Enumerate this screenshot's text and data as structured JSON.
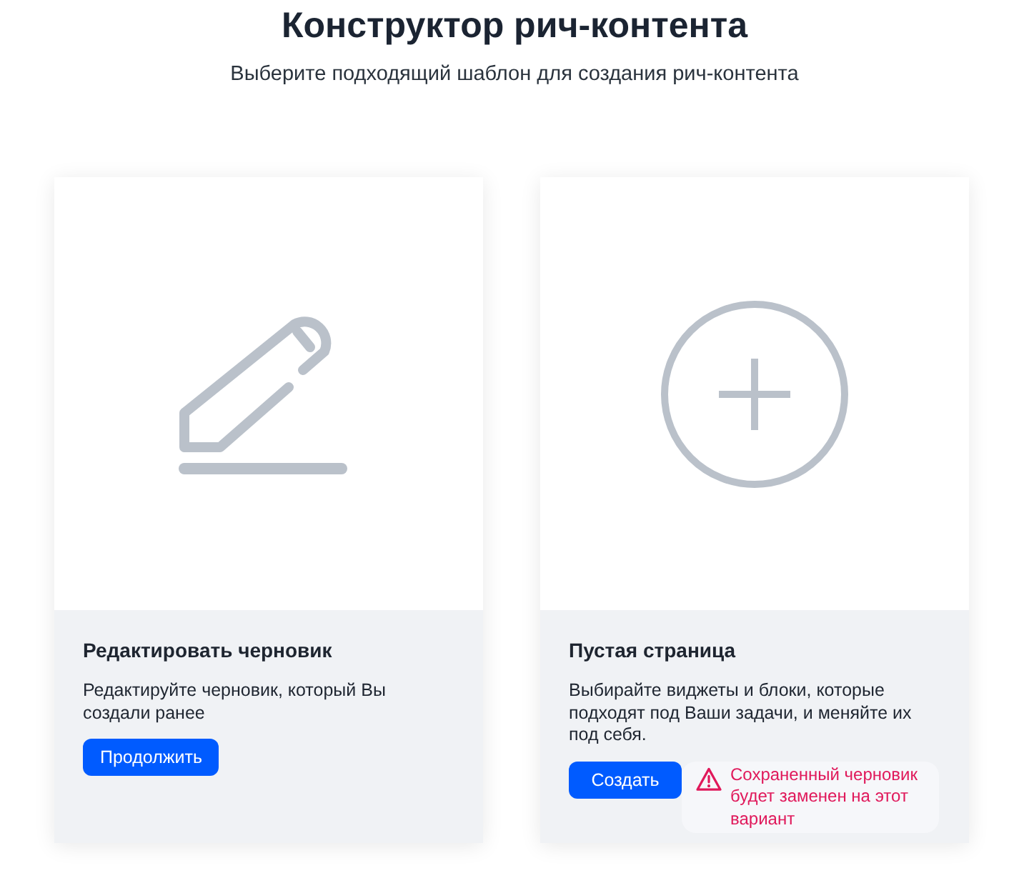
{
  "header": {
    "title": "Конструктор рич-контента",
    "subtitle": "Выберите подходящий шаблон для создания рич-контента"
  },
  "cards": [
    {
      "kind": "edit",
      "title": "Редактировать черновик",
      "description": "Редактируйте черновик, который Вы создали ранее",
      "button": "Продолжить"
    },
    {
      "kind": "blank",
      "title": "Пустая страница",
      "description": "Выбирайте виджеты и блоки, которые подходят под Ваши задачи, и меняйте их под себя.",
      "button": "Создать",
      "warning": "Сохраненный черновик будет заменен на этот вариант"
    }
  ]
}
